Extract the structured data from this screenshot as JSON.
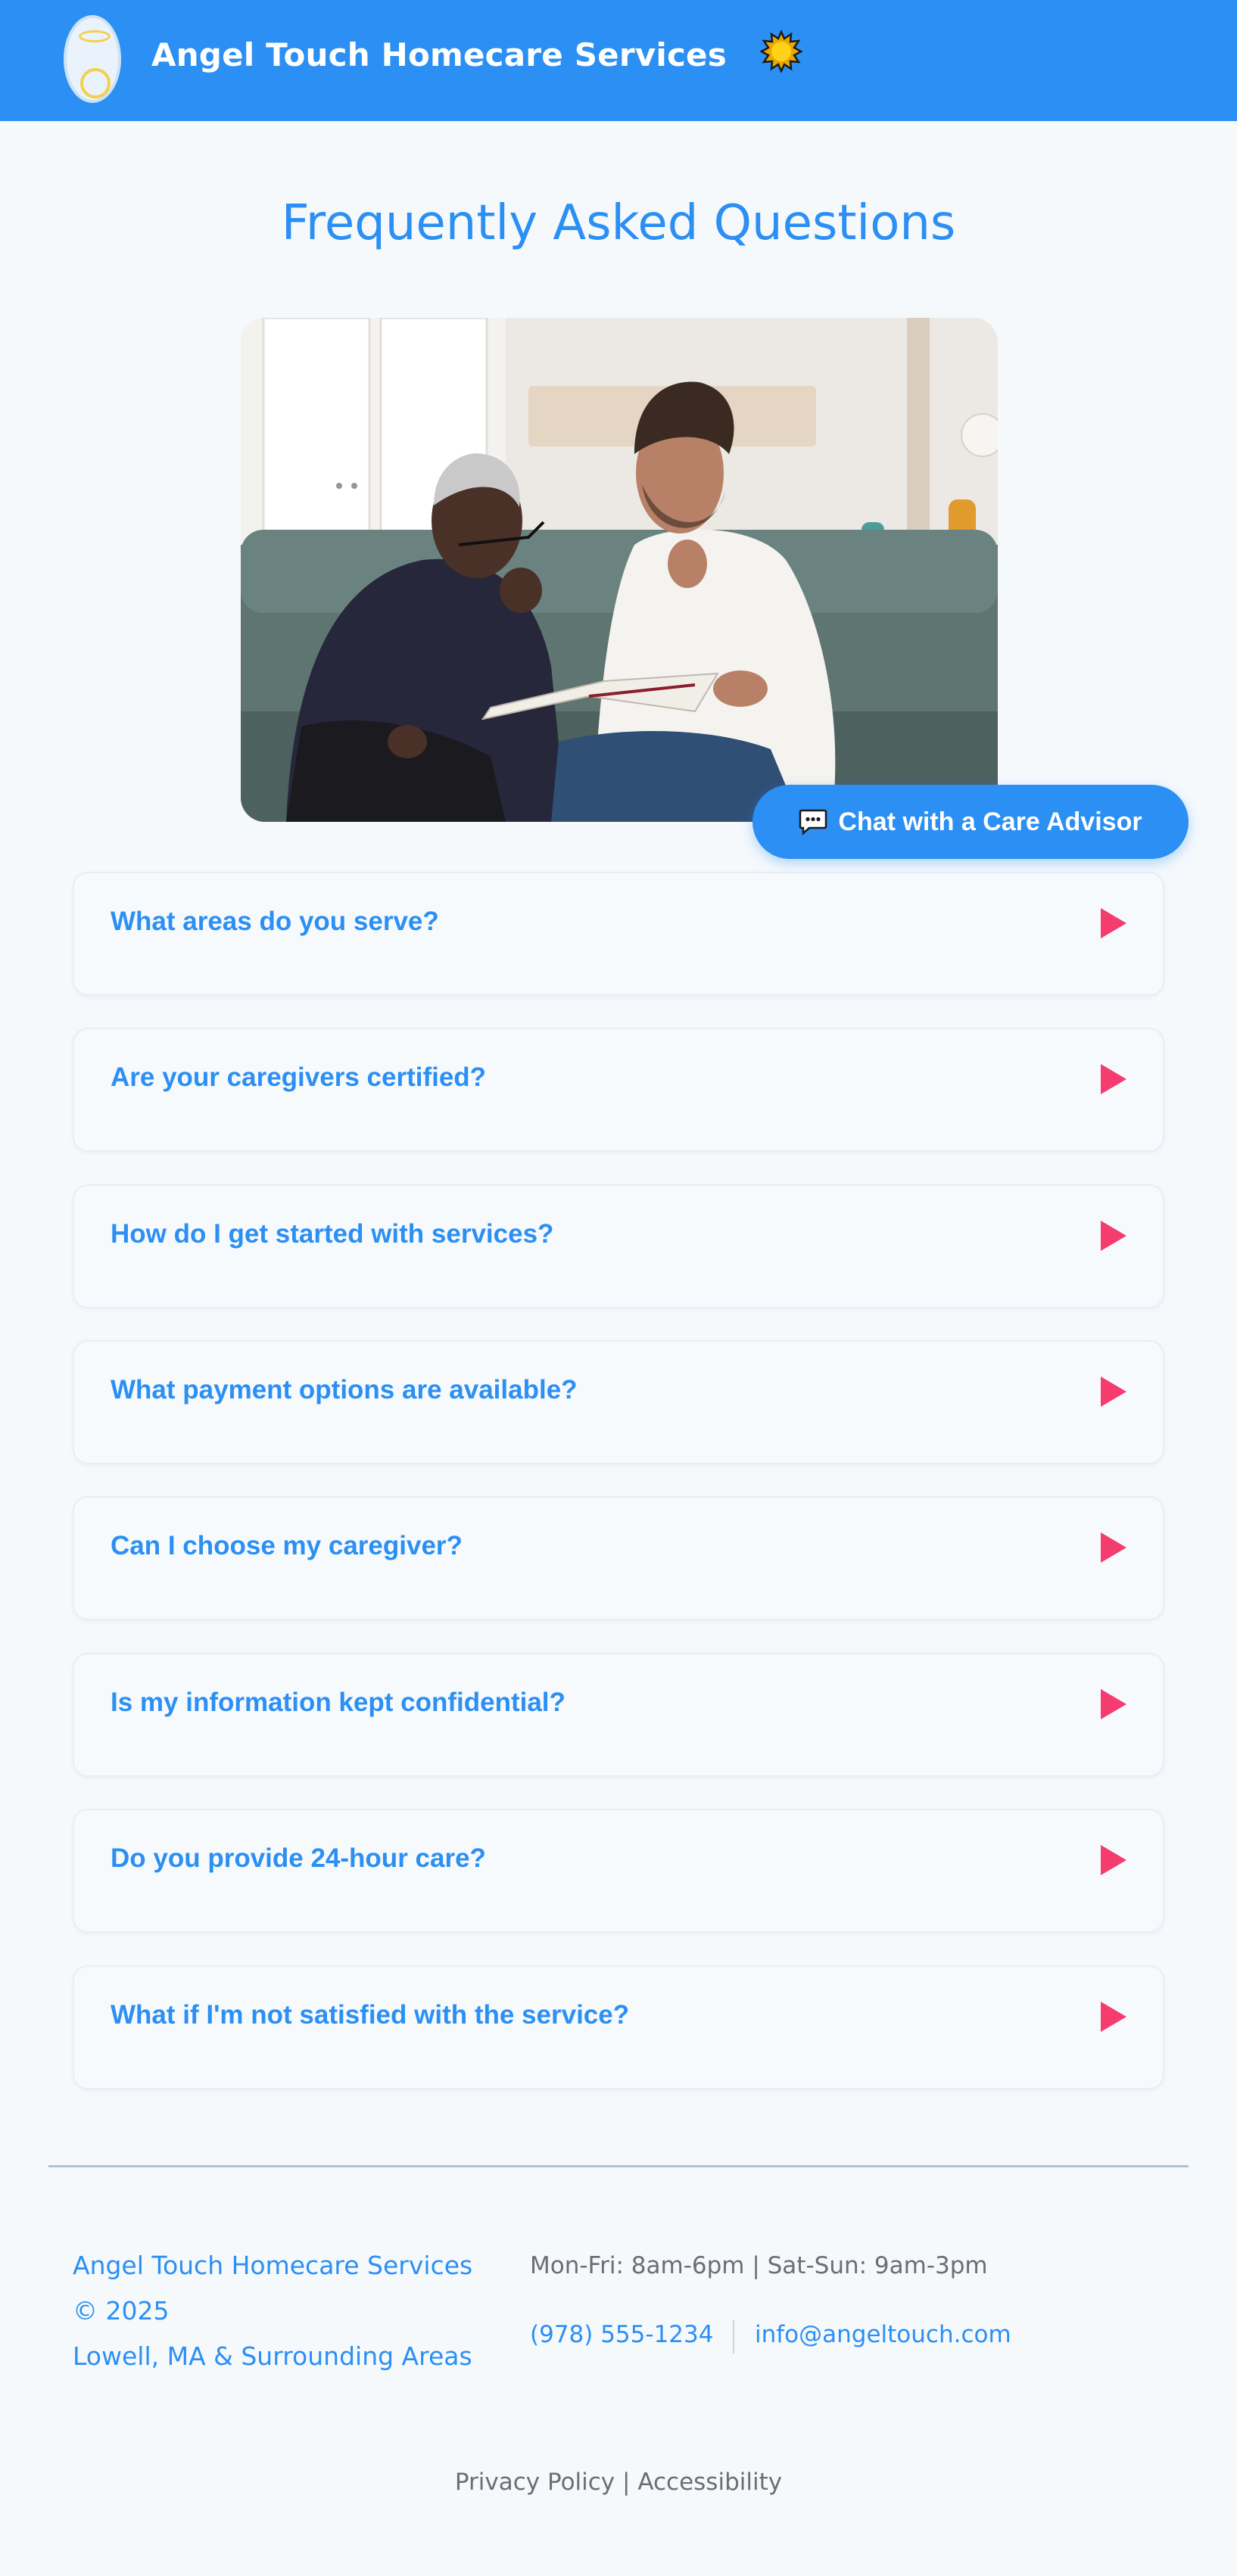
{
  "header": {
    "brand_name": "Angel Touch Homecare Services",
    "logo_icon": "angel-halo-logo",
    "theme_icon": "sun-icon",
    "color": "#2b8ff3"
  },
  "main": {
    "title": "Frequently Asked Questions",
    "image_icon": "caregiver-reading-with-senior-photo",
    "chat_button": {
      "label": "Chat with a Care Advisor",
      "icon": "speech-bubble-icon"
    },
    "faqs": [
      {
        "question": "What areas do you serve?"
      },
      {
        "question": "Are your caregivers certified?"
      },
      {
        "question": "How do I get started with services?"
      },
      {
        "question": "What payment options are available?"
      },
      {
        "question": "Can I choose my caregiver?"
      },
      {
        "question": "Is my information kept confidential?"
      },
      {
        "question": "Do you provide 24-hour care?"
      },
      {
        "question": "What if I'm not satisfied with the service?"
      }
    ],
    "arrow_color": "#f53c6e"
  },
  "footer": {
    "company_line1": "Angel Touch Homecare Services",
    "company_line2": "© 2025",
    "company_line3": "Lowell, MA & Surrounding Areas",
    "hours": "Mon-Fri: 8am-6pm | Sat-Sun: 9am-3pm",
    "phone": "(978) 555-1234",
    "email": "info@angeltouch.com",
    "privacy": "Privacy Policy",
    "legal_sep": "|",
    "accessibility": "Accessibility"
  }
}
